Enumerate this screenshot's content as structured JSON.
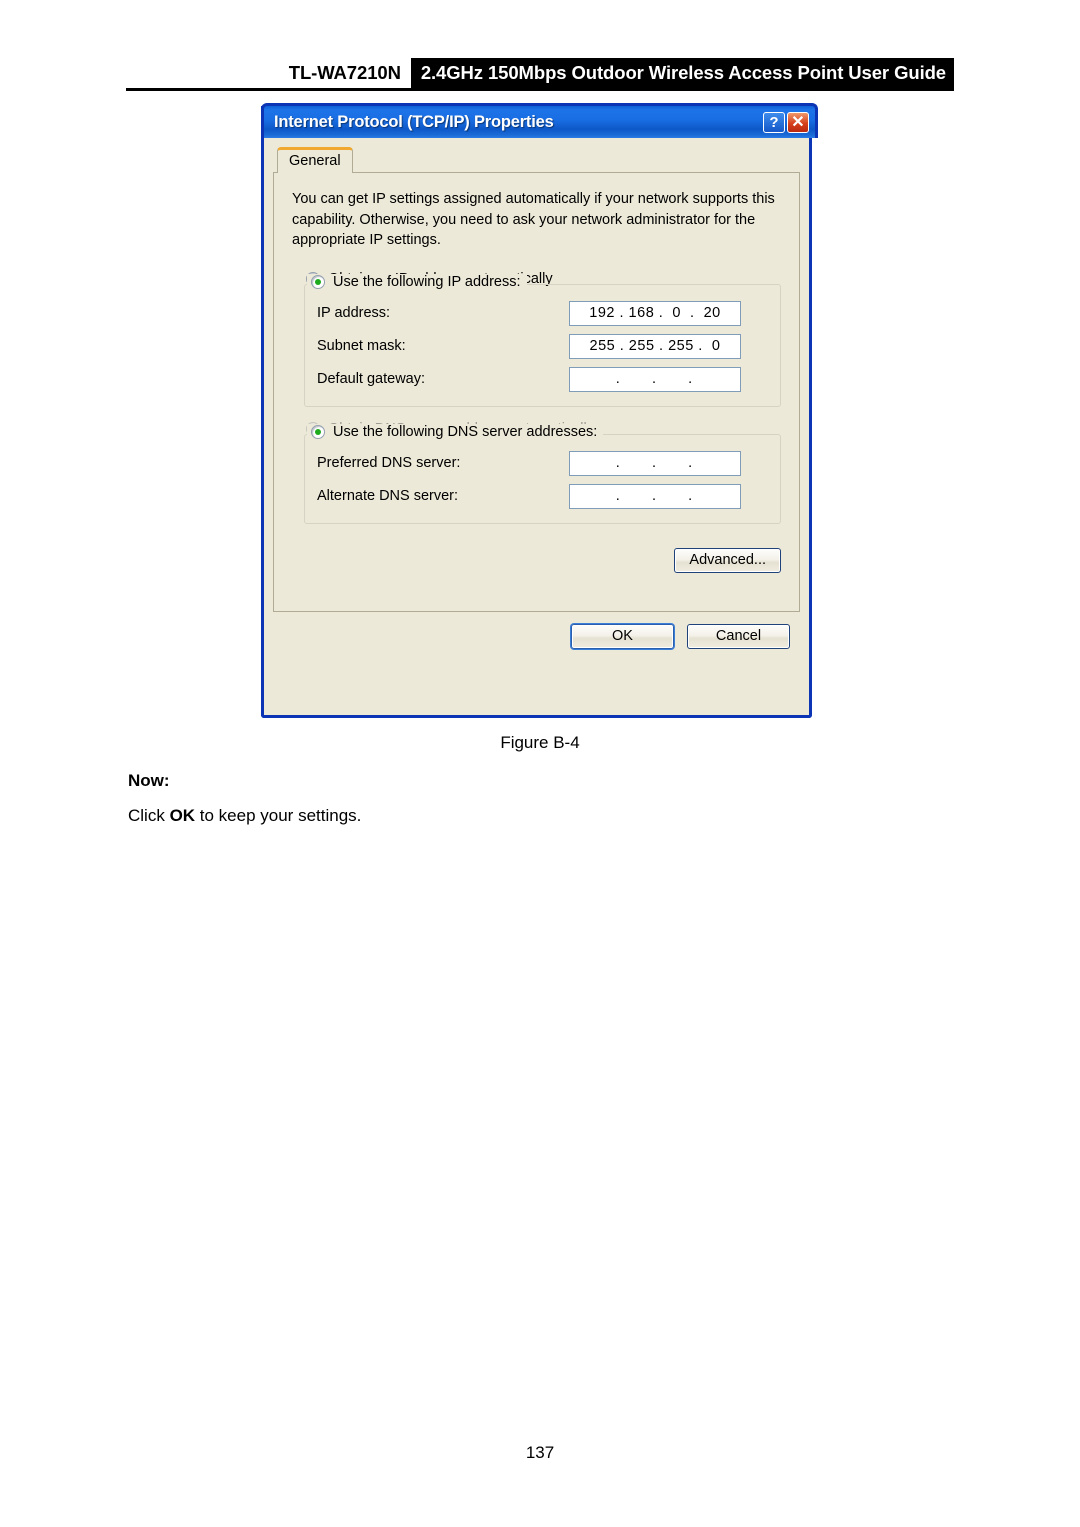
{
  "page": {
    "header": {
      "model": "TL-WA7210N",
      "title": "2.4GHz 150Mbps Outdoor Wireless Access Point User Guide"
    },
    "figure_caption": "Figure B-4",
    "now_label": "Now:",
    "instruction_prefix": "Click ",
    "instruction_bold": "OK",
    "instruction_suffix": " to keep your settings.",
    "page_number": "137"
  },
  "dialog": {
    "title": "Internet Protocol (TCP/IP) Properties",
    "help_button": "?",
    "close_button": "✕",
    "tabs": [
      {
        "label": "General",
        "selected": true
      }
    ],
    "intro_text": "You can get IP settings assigned automatically if your network supports this capability. Otherwise, you need to ask your network administrator for the appropriate IP settings.",
    "ip_section": {
      "auto_radio_label": "Obtain an IP address automatically",
      "auto_radio_checked": false,
      "manual_radio_label": "Use the following IP address:",
      "manual_radio_checked": true,
      "fields": [
        {
          "label": "IP address:",
          "value": "192 . 168 .  0  .  20",
          "empty": false
        },
        {
          "label": "Subnet mask:",
          "value": "255 . 255 . 255 .  0",
          "empty": false
        },
        {
          "label": "Default gateway:",
          "value": " .     .     . ",
          "empty": true
        }
      ]
    },
    "dns_section": {
      "auto_radio_label": "Obtain DNS server address automatically",
      "auto_radio_checked": false,
      "auto_radio_disabled": true,
      "manual_radio_label": "Use the following DNS server addresses:",
      "manual_radio_checked": true,
      "fields": [
        {
          "label": "Preferred DNS server:",
          "value": " .     .     . ",
          "empty": true
        },
        {
          "label": "Alternate DNS server:",
          "value": " .     .     . ",
          "empty": true
        }
      ]
    },
    "buttons": {
      "advanced": "Advanced...",
      "ok": "OK",
      "cancel": "Cancel"
    }
  },
  "colors": {
    "titlebar_blue": "#1a6ee4",
    "dialog_border": "#0b35b5",
    "dialog_face": "#ece9d8",
    "radio_dot_green": "#1eac1e",
    "tab_accent_orange": "#f0a830",
    "field_border": "#7f9db9"
  }
}
